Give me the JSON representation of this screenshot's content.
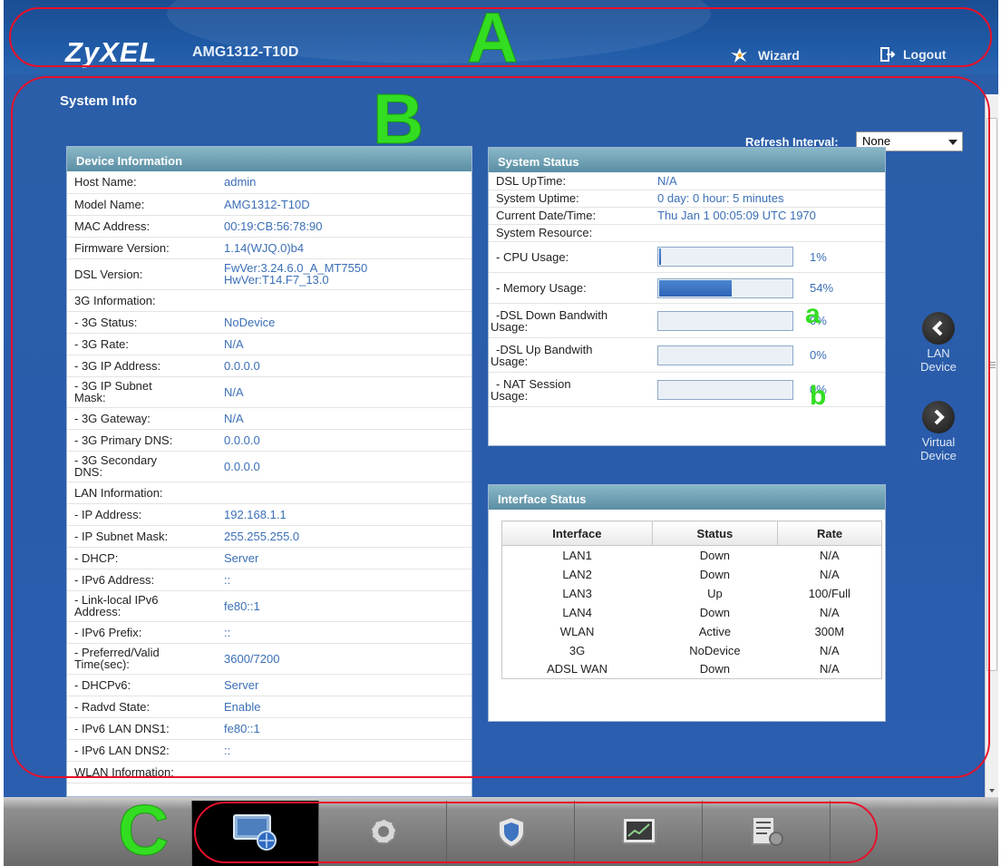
{
  "header": {
    "logo": "ZyXEL",
    "model": "AMG1312-T10D",
    "wizard_label": "Wizard",
    "logout_label": "Logout"
  },
  "callouts": {
    "A": "A",
    "B": "B",
    "C": "C",
    "a": "a",
    "b": "b"
  },
  "page": {
    "title": "System Info",
    "refresh_label": "Refresh Interval:",
    "refresh_value": "None"
  },
  "device_info": {
    "title": "Device Information",
    "rows": [
      {
        "k": "Host Name:",
        "v": "admin"
      },
      {
        "k": "Model Name:",
        "v": "AMG1312-T10D"
      },
      {
        "k": "MAC Address:",
        "v": "00:19:CB:56:78:90"
      },
      {
        "k": "Firmware Version:",
        "v": "1.14(WJQ.0)b4"
      },
      {
        "k": "DSL Version:",
        "v": "FwVer:3.24.6.0_A_MT7550",
        "v2": "HwVer:T14.F7_13.0"
      },
      {
        "k": "3G Information:",
        "v": ""
      },
      {
        "k": "- 3G Status:",
        "v": "NoDevice"
      },
      {
        "k": "- 3G Rate:",
        "v": "N/A"
      },
      {
        "k": "- 3G IP Address:",
        "v": "0.0.0.0"
      },
      {
        "k": "- 3G IP Subnet",
        "k2": "Mask:",
        "v": "N/A"
      },
      {
        "k": "- 3G Gateway:",
        "v": "N/A"
      },
      {
        "k": "- 3G Primary DNS:",
        "v": "0.0.0.0"
      },
      {
        "k": "- 3G Secondary",
        "k2": "DNS:",
        "v": "0.0.0.0"
      },
      {
        "k": "LAN Information:",
        "v": ""
      },
      {
        "k": "- IP Address:",
        "v": "192.168.1.1"
      },
      {
        "k": "- IP Subnet Mask:",
        "v": "255.255.255.0"
      },
      {
        "k": "- DHCP:",
        "v": "Server"
      },
      {
        "k": "- IPv6 Address:",
        "v": "::"
      },
      {
        "k": "- Link-local IPv6",
        "k2": "Address:",
        "v": "fe80::1"
      },
      {
        "k": "- IPv6 Prefix:",
        "v": "::"
      },
      {
        "k": "- Preferred/Valid",
        "k2": "Time(sec):",
        "v": "3600/7200"
      },
      {
        "k": "- DHCPv6:",
        "v": "Server"
      },
      {
        "k": "- Radvd State:",
        "v": "Enable"
      },
      {
        "k": "- IPv6 LAN DNS1:",
        "v": "fe80::1"
      },
      {
        "k": "- IPv6 LAN DNS2:",
        "v": "::"
      },
      {
        "k": "WLAN Information:",
        "v": ""
      }
    ]
  },
  "system_status": {
    "title": "System Status",
    "dsl_uptime_label": "DSL UpTime:",
    "dsl_uptime": "N/A",
    "system_uptime_label": "System Uptime:",
    "system_uptime": "0 day: 0 hour: 5 minutes",
    "date_label": "Current Date/Time:",
    "date": "Thu Jan 1 00:05:09 UTC 1970",
    "resource_label": "System Resource:",
    "resources": [
      {
        "label": "- CPU Usage:",
        "label2": "",
        "pct": "1%",
        "fill": 0.01
      },
      {
        "label": "- Memory Usage:",
        "label2": "",
        "pct": "54%",
        "fill": 0.54
      },
      {
        "label": "-DSL Down Bandwith",
        "label2": "Usage:",
        "pct": "0%",
        "fill": 0
      },
      {
        "label": "-DSL Up Bandwith",
        "label2": "Usage:",
        "pct": "0%",
        "fill": 0
      },
      {
        "label": "- NAT Session",
        "label2": "Usage:",
        "pct": "0%",
        "fill": 0
      }
    ]
  },
  "interface_status": {
    "title": "Interface Status",
    "columns": [
      "Interface",
      "Status",
      "Rate"
    ],
    "rows": [
      [
        "LAN1",
        "Down",
        "N/A"
      ],
      [
        "LAN2",
        "Down",
        "N/A"
      ],
      [
        "LAN3",
        "Up",
        "100/Full"
      ],
      [
        "LAN4",
        "Down",
        "N/A"
      ],
      [
        "WLAN",
        "Active",
        "300M"
      ],
      [
        "3G",
        "NoDevice",
        "N/A"
      ],
      [
        "ADSL WAN",
        "Down",
        "N/A"
      ]
    ]
  },
  "sidenav": {
    "prev_line1": "LAN",
    "prev_line2": "Device",
    "next_line1": "Virtual",
    "next_line2": "Device"
  },
  "bottom_nav": {
    "items": [
      "connection-status-icon",
      "gear-icon",
      "shield-icon",
      "monitor-chart-icon",
      "maintenance-icon"
    ],
    "active_index": 0
  },
  "colors": {
    "value_text": "#3b6fb6",
    "callout_red": "#e8102a",
    "callout_green": "#33dd22"
  }
}
